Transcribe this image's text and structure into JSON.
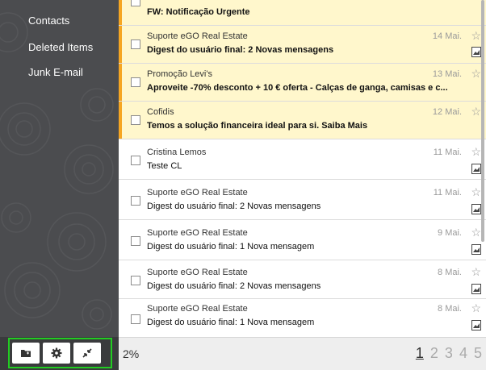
{
  "sidebar": {
    "folders": [
      {
        "label": "Contacts"
      },
      {
        "label": "Deleted Items"
      },
      {
        "label": "Junk E-mail"
      }
    ],
    "footer_buttons": [
      {
        "icon": "folder-icon"
      },
      {
        "icon": "gear-icon"
      },
      {
        "icon": "collapse-icon"
      }
    ]
  },
  "messages": [
    {
      "from": "",
      "subject": "FW: Notificação Urgente",
      "date": "",
      "unread": true,
      "star": false,
      "attachment": false
    },
    {
      "from": "Suporte eGO Real Estate",
      "subject": "Digest do usuário final: 2 Novas mensagens",
      "date": "14 Mai.",
      "unread": true,
      "attachment": true
    },
    {
      "from": "Promoção Levi's",
      "subject": "Aproveite -70% desconto + 10 € oferta - Calças de ganga, camisas e c...",
      "date": "13 Mai.",
      "unread": true,
      "attachment": false
    },
    {
      "from": "Cofidis",
      "subject": "Temos a solução financeira ideal para si. Saiba Mais",
      "date": "12 Mai.",
      "unread": true,
      "attachment": false
    },
    {
      "from": "Cristina Lemos",
      "subject": "Teste CL",
      "date": "11 Mai.",
      "unread": false,
      "attachment": true
    },
    {
      "from": "Suporte eGO Real Estate",
      "subject": "Digest do usuário final: 2 Novas mensagens",
      "date": "11 Mai.",
      "unread": false,
      "attachment": true
    },
    {
      "from": "Suporte eGO Real Estate",
      "subject": "Digest do usuário final: 1 Nova mensagem",
      "date": "9 Mai.",
      "unread": false,
      "attachment": true
    },
    {
      "from": "Suporte eGO Real Estate",
      "subject": "Digest do usuário final: 2 Novas mensagens",
      "date": "8 Mai.",
      "unread": false,
      "attachment": true
    },
    {
      "from": "Suporte eGO Real Estate",
      "subject": "Digest do usuário final: 1 Nova mensagem",
      "date": "8 Mai.",
      "unread": false,
      "attachment": true
    }
  ],
  "footer": {
    "percent": "2%",
    "pages": [
      "1",
      "2",
      "3",
      "4",
      "5"
    ],
    "current_page": "1"
  },
  "colors": {
    "sidebar": "#4b4c4f",
    "unread_bg": "#fff7cc",
    "accent_bar": "#f6a623",
    "highlight": "#22cc22"
  }
}
